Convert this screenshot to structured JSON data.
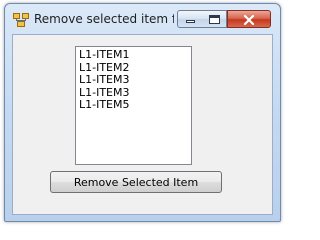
{
  "window": {
    "title": "Remove selected item fr...",
    "icon": "winforms-app-icon",
    "controls": {
      "minimize": "minimize-icon",
      "maximize": "maximize-icon",
      "close": "close-icon"
    }
  },
  "listbox": {
    "items": [
      "L1-ITEM1",
      "L1-ITEM2",
      "L1-ITEM3",
      "L1-ITEM3",
      "L1-ITEM5"
    ]
  },
  "button": {
    "label": "Remove Selected Item"
  },
  "colors": {
    "close_button": "#c4381e",
    "frame": "#b9d0ec",
    "client": "#f0f0f0"
  }
}
